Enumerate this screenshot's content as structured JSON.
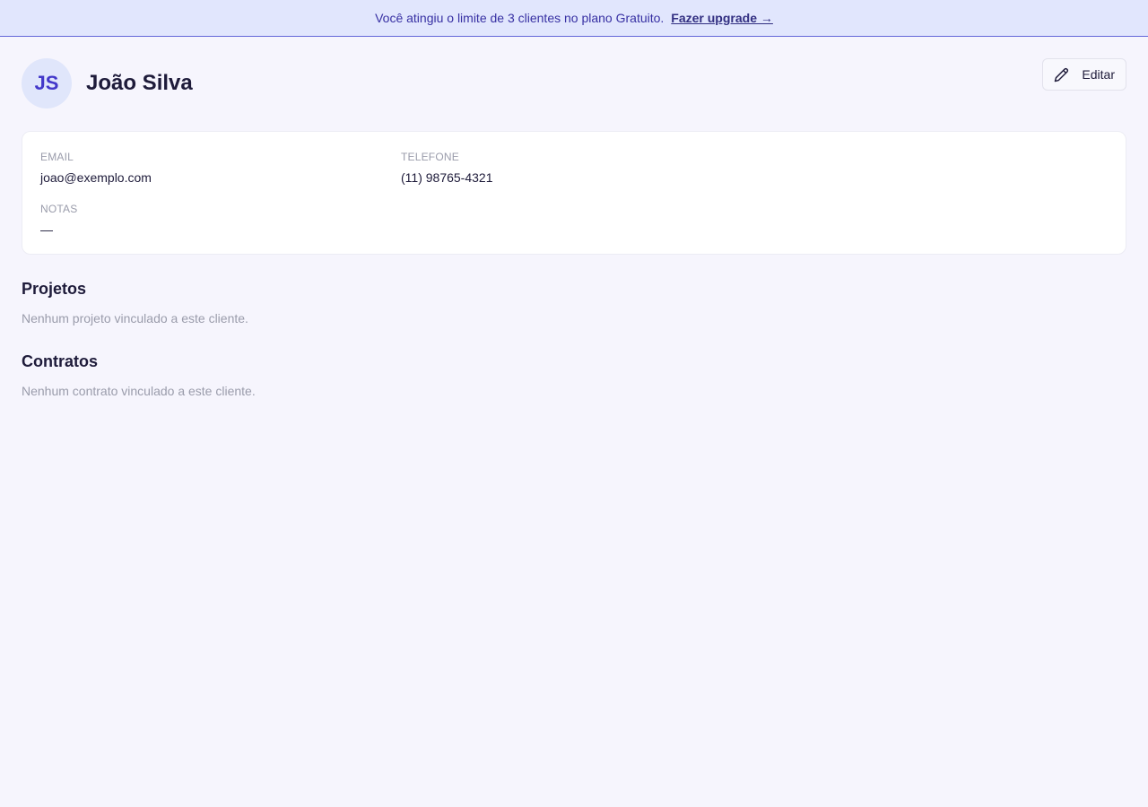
{
  "banner": {
    "message": "Você atingiu o limite de 3 clientes no plano Gratuito.",
    "link_label": "Fazer upgrade →"
  },
  "client": {
    "initials": "JS",
    "name": "João Silva"
  },
  "toolbar": {
    "edit_label": "Editar",
    "edit_icon": "pencil-icon"
  },
  "details": {
    "email_label": "EMAIL",
    "email_value": "joao@exemplo.com",
    "phone_label": "TELEFONE",
    "phone_value": "(11) 98765-4321",
    "notes_label": "NOTAS",
    "notes_value": "—"
  },
  "projects": {
    "title": "Projetos",
    "empty_text": "Nenhum projeto vinculado a este cliente."
  },
  "contracts": {
    "title": "Contratos",
    "empty_text": "Nenhum contrato vinculado a este cliente."
  },
  "colors": {
    "accent": "#4338ca",
    "banner_bg": "#e1e6fd",
    "page_bg": "#f6f5fd"
  }
}
